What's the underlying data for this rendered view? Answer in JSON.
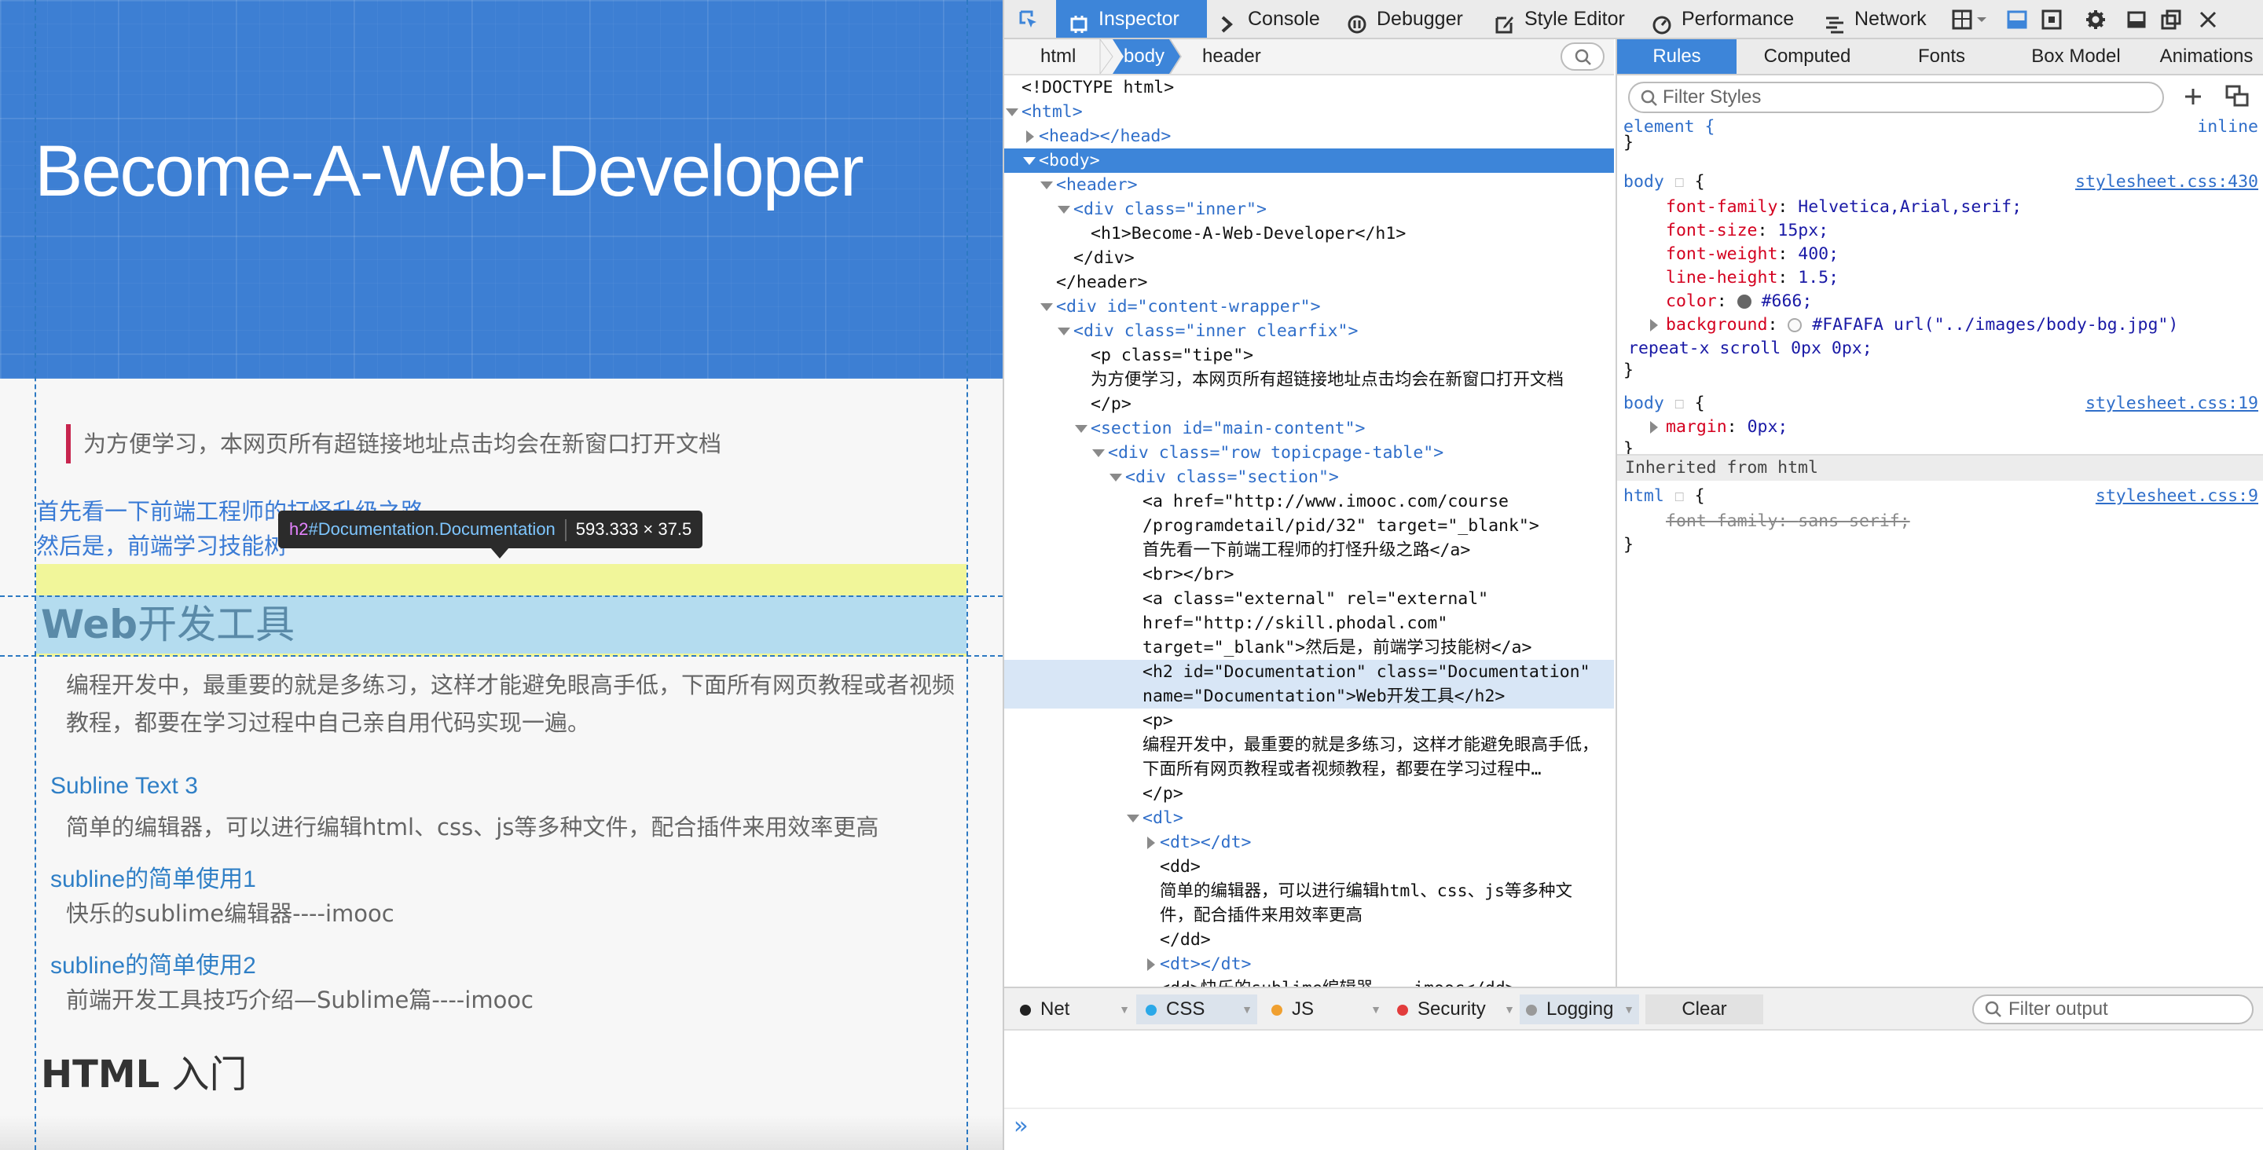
{
  "page": {
    "header_title": "Become-A-Web-Developer",
    "tip": "为方便学习，本网页所有超链接地址点击均会在新窗口打开文档",
    "links": [
      "首先看一下前端工程师的打怪升级之路",
      "然后是，前端学习技能树"
    ],
    "h2_latin": "Web",
    "h2_cn": "开发工具",
    "paragraph": "编程开发中，最重要的就是多练习，这样才能避免眼高手低，下面所有网页教程或者视频教程，都要在学习过程中自己亲自用代码实现一遍。",
    "dl": [
      {
        "dt": "Subline Text 3",
        "dd": "简单的编辑器，可以进行编辑html、css、js等多种文件，配合插件来用效率更高"
      },
      {
        "dt": "subline的简单使用1",
        "dd": "快乐的sublime编辑器----imooc"
      },
      {
        "dt": "subline的简单使用2",
        "dd": "前端开发工具技巧介绍—Sublime篇----imooc"
      }
    ],
    "h2_html_latin": "HTML",
    "h2_html_cn": " 入门"
  },
  "tooltip": {
    "tag": "h2",
    "id": "#Documentation",
    "cls": ".Documentation",
    "size": "593.333 × 37.5"
  },
  "toolbar": {
    "inspector": "Inspector",
    "console": "Console",
    "debugger": "Debugger",
    "style_editor": "Style Editor",
    "performance": "Performance",
    "network": "Network"
  },
  "breadcrumbs": [
    "html",
    "body",
    "header"
  ],
  "markup": [
    "<!DOCTYPE html>",
    "<html>",
    "<head></head>",
    "<body>",
    "<header>",
    "<div class=\"inner\">",
    "<h1>Become-A-Web-Developer</h1>",
    "</div>",
    "</header>",
    "<div id=\"content-wrapper\">",
    "<div class=\"inner clearfix\">",
    "<p class=\"tipe\">",
    "为方便学习，本网页所有超链接地址点击均会在新窗口打开文档",
    "</p>",
    "<section id=\"main-content\">",
    "<div class=\"row topicpage-table\">",
    "<div class=\"section\">",
    "<a href=\"http://www.imooc.com/course",
    "/programdetail/pid/32\" target=\"_blank\">",
    "首先看一下前端工程师的打怪升级之路</a>",
    "<br></br>",
    "<a class=\"external\" rel=\"external\"",
    "href=\"http://skill.phodal.com\"",
    "target=\"_blank\">然后是，前端学习技能树</a>",
    "<h2 id=\"Documentation\" class=\"Documentation\"",
    "name=\"Documentation\">Web开发工具</h2>",
    "<p>",
    "编程开发中，最重要的就是多练习，这样才能避免眼高手低，",
    "下面所有网页教程或者视频教程，都要在学习过程中…",
    "</p>",
    "<dl>",
    "<dt></dt>",
    "<dd>",
    "简单的编辑器，可以进行编辑html、css、js等多种文",
    "件，配合插件来用效率更高",
    "</dd>",
    "<dt></dt>",
    "<dd>快乐的sublime编辑器----imooc</dd>"
  ],
  "rules_tabs": [
    "Rules",
    "Computed",
    "Fonts",
    "Box Model",
    "Animations"
  ],
  "rules_filter_placeholder": "Filter Styles",
  "rules": {
    "element_selector": "element {",
    "element_src": "inline",
    "close": "}",
    "body1_selector": "body",
    "body1_src": "stylesheet.css:430",
    "body1_props": [
      {
        "name": "font-family",
        "value": "Helvetica,Arial,serif;"
      },
      {
        "name": "font-size",
        "value": "15px;"
      },
      {
        "name": "font-weight",
        "value": "400;"
      },
      {
        "name": "line-height",
        "value": "1.5;"
      },
      {
        "name": "color",
        "value": "#666;"
      },
      {
        "name": "background",
        "value": "#FAFAFA url(\"../images/body-bg.jpg\")"
      }
    ],
    "body1_bg_cont": "repeat-x scroll 0px 0px;",
    "body2_selector": "body",
    "body2_src": "stylesheet.css:19",
    "body2_prop": {
      "name": "margin",
      "value": "0px;"
    },
    "inherited_label": "Inherited from html",
    "html_selector": "html",
    "html_src": "stylesheet.css:9",
    "html_prop": {
      "name": "font-family",
      "value": "sans-serif;"
    }
  },
  "console": {
    "net": "Net",
    "css": "CSS",
    "js": "JS",
    "security": "Security",
    "logging": "Logging",
    "clear": "Clear",
    "filter_placeholder": "Filter output",
    "prompt": "»",
    "colors": {
      "net": "#222222",
      "css": "#2aa8e8",
      "js": "#f0a030",
      "security": "#e23c3c",
      "logging": "#999999"
    }
  }
}
